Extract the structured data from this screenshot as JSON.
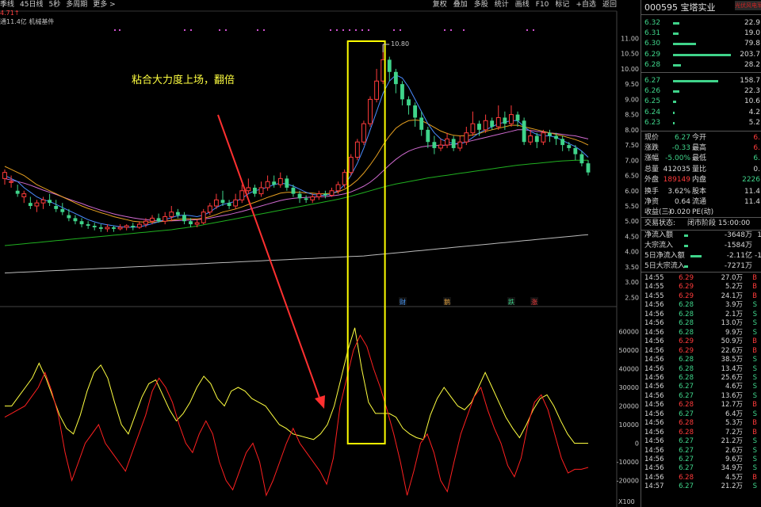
{
  "toolbar": {
    "left_items": [
      "季线",
      "45日线",
      "5秒",
      "多周期",
      "更多 >"
    ],
    "right_items": [
      "复权",
      "叠加",
      "多股",
      "统计",
      "画线",
      "F10",
      "标记",
      "+自选",
      "返回"
    ]
  },
  "chart_info": {
    "price_marker": "4.71↑",
    "flow_line": "通11.4亿 机械基件"
  },
  "annotation": {
    "text": "粘合大力度上场，翻倍",
    "high_label": "10.80"
  },
  "event_markers": [
    {
      "text": "财",
      "color": "#4a9cff"
    },
    {
      "text": "鹅",
      "color": "#e0a040"
    },
    {
      "text": "跌",
      "color": "#3fd48a"
    },
    {
      "text": "涨",
      "color": "#ff4040"
    }
  ],
  "price_axis": {
    "labels": [
      "11.00",
      "10.50",
      "10.00",
      "9.50",
      "9.00",
      "8.50",
      "8.00",
      "7.50",
      "7.00",
      "6.50",
      "6.00",
      "5.50",
      "5.00",
      "4.50",
      "4.00",
      "3.50",
      "3.00",
      "2.50"
    ],
    "range": [
      2.25,
      11.35
    ]
  },
  "indicator_axis": {
    "labels": [
      "60000",
      "50000",
      "40000",
      "30000",
      "20000",
      "10000",
      "0",
      "-10000",
      "-20000"
    ],
    "range": [
      -30000,
      70000
    ],
    "corner_label": "X100"
  },
  "quote": {
    "code": "000595",
    "name": "宝塔实业",
    "tag": "光伏风电军工",
    "asks": [
      {
        "price": "6.32",
        "vol": "22.9"
      },
      {
        "price": "6.31",
        "vol": "19.0"
      },
      {
        "price": "6.30",
        "vol": "79.8"
      },
      {
        "price": "6.29",
        "vol": "203.7"
      },
      {
        "price": "6.28",
        "vol": "28.2"
      }
    ],
    "bids": [
      {
        "price": "6.27",
        "vol": "158.7"
      },
      {
        "price": "6.26",
        "vol": "22.3"
      },
      {
        "price": "6.25",
        "vol": "10.6"
      },
      {
        "price": "6.24",
        "vol": "4.2"
      },
      {
        "price": "6.23",
        "vol": "5.2"
      }
    ],
    "stats": [
      {
        "l1": "现价",
        "v1": "6.27",
        "c1": "cg",
        "l2": "今开",
        "v2": "6.",
        "c2": "cr"
      },
      {
        "l1": "涨跌",
        "v1": "-0.33",
        "c1": "cg",
        "l2": "最高",
        "v2": "6.",
        "c2": "cr"
      },
      {
        "l1": "涨幅",
        "v1": "-5.00%",
        "c1": "cg",
        "l2": "最低",
        "v2": "6.",
        "c2": "cg"
      },
      {
        "l1": "总量",
        "v1": "412035",
        "c1": "cw",
        "l2": "量比",
        "v2": "0.",
        "c2": "cw"
      },
      {
        "l1": "外盘",
        "v1": "189149",
        "c1": "cr",
        "l2": "内盘",
        "v2": "2226",
        "c2": "cg"
      },
      {
        "l1": "换手",
        "v1": "3.62%",
        "c1": "cw",
        "l2": "股本",
        "v2": "11.4",
        "c2": "cw"
      },
      {
        "l1": "净资",
        "v1": "0.64",
        "c1": "cw",
        "l2": "流通",
        "v2": "11.4",
        "c2": "cw"
      },
      {
        "l1": "收益(三)",
        "v1": "-0.020",
        "c1": "cw",
        "l2": "PE(动)",
        "v2": "",
        "c2": "cw"
      }
    ],
    "status_label": "交易状态:",
    "status_value": "闭市阶段 15:00:00",
    "flows": [
      {
        "label": "净流入额",
        "value": "-3648万",
        "extra": "1"
      },
      {
        "label": "大宗流入",
        "value": "-1584万",
        "extra": ""
      },
      {
        "label": "5日净流入额",
        "value": "-2.11亿",
        "extra": "-1"
      },
      {
        "label": "5日大宗流入",
        "value": "-7271万",
        "extra": ""
      }
    ],
    "trades": [
      [
        "14:55",
        "6.29",
        "27.0万",
        "B"
      ],
      [
        "14:55",
        "6.29",
        "5.2万",
        "B"
      ],
      [
        "14:55",
        "6.29",
        "24.1万",
        "B"
      ],
      [
        "14:56",
        "6.28",
        "3.9万",
        "S"
      ],
      [
        "14:56",
        "6.28",
        "2.1万",
        "S"
      ],
      [
        "14:56",
        "6.28",
        "13.0万",
        "S"
      ],
      [
        "14:56",
        "6.28",
        "9.9万",
        "S"
      ],
      [
        "14:56",
        "6.29",
        "50.9万",
        "B"
      ],
      [
        "14:56",
        "6.29",
        "22.6万",
        "B"
      ],
      [
        "14:56",
        "6.28",
        "38.5万",
        "S"
      ],
      [
        "14:56",
        "6.28",
        "13.4万",
        "S"
      ],
      [
        "14:56",
        "6.28",
        "25.6万",
        "S"
      ],
      [
        "14:56",
        "6.27",
        "4.6万",
        "S"
      ],
      [
        "14:56",
        "6.27",
        "13.6万",
        "S"
      ],
      [
        "14:56",
        "6.28",
        "12.7万",
        "B"
      ],
      [
        "14:56",
        "6.27",
        "6.4万",
        "S"
      ],
      [
        "14:56",
        "6.28",
        "5.3万",
        "B"
      ],
      [
        "14:56",
        "6.28",
        "7.2万",
        "B"
      ],
      [
        "14:56",
        "6.27",
        "21.2万",
        "S"
      ],
      [
        "14:56",
        "6.27",
        "2.6万",
        "S"
      ],
      [
        "14:56",
        "6.27",
        "9.6万",
        "S"
      ],
      [
        "14:56",
        "6.27",
        "34.9万",
        "S"
      ],
      [
        "14:56",
        "6.28",
        "4.5万",
        "B"
      ],
      [
        "14:57",
        "6.27",
        "21.2万",
        "S"
      ]
    ]
  },
  "colors": {
    "up": "#ff3b3b",
    "down": "#3fd48a",
    "ma_blue": "#4a8cff",
    "ma_orange": "#e6a020",
    "ma_magenta": "#d06ad0",
    "ma_green": "#20b020",
    "ma_gray": "#bbbbbb",
    "ind_yellow": "#ffff40",
    "ind_red": "#ff2020",
    "highlight_box": "#ffff00",
    "arrow": "#ff3030"
  },
  "chart_data": {
    "type": "candlestick",
    "candles": [
      [
        6.4,
        6.6,
        6.7,
        6.2
      ],
      [
        6.3,
        6.3,
        6.5,
        6.1
      ],
      [
        6.0,
        5.9,
        6.2,
        5.8
      ],
      [
        5.8,
        5.9,
        6.0,
        5.6
      ],
      [
        5.6,
        5.5,
        5.8,
        5.4
      ],
      [
        5.5,
        5.6,
        5.7,
        5.3
      ],
      [
        5.6,
        5.7,
        5.8,
        5.4
      ],
      [
        5.7,
        5.6,
        5.9,
        5.5
      ],
      [
        5.5,
        5.4,
        5.7,
        5.3
      ],
      [
        5.4,
        5.3,
        5.6,
        5.2
      ],
      [
        5.2,
        5.1,
        5.4,
        5.0
      ],
      [
        5.1,
        5.0,
        5.2,
        4.9
      ],
      [
        5.0,
        4.9,
        5.1,
        4.8
      ],
      [
        4.9,
        4.85,
        5.0,
        4.75
      ],
      [
        4.85,
        4.8,
        4.95,
        4.7
      ],
      [
        4.8,
        4.75,
        4.9,
        4.65
      ],
      [
        4.75,
        4.8,
        4.9,
        4.65
      ],
      [
        4.8,
        4.75,
        4.85,
        4.65
      ],
      [
        4.75,
        4.8,
        4.9,
        4.7
      ],
      [
        4.8,
        4.85,
        4.9,
        4.7
      ],
      [
        4.85,
        4.8,
        4.95,
        4.7
      ],
      [
        4.8,
        4.9,
        5.0,
        4.75
      ],
      [
        4.9,
        5.0,
        5.1,
        4.8
      ],
      [
        5.0,
        5.1,
        5.2,
        4.9
      ],
      [
        5.1,
        5.0,
        5.25,
        4.95
      ],
      [
        5.0,
        5.15,
        5.3,
        4.9
      ],
      [
        5.15,
        5.3,
        5.5,
        5.0
      ],
      [
        5.3,
        5.2,
        5.4,
        5.1
      ],
      [
        5.2,
        5.0,
        5.3,
        4.9
      ],
      [
        5.0,
        4.9,
        5.1,
        4.8
      ],
      [
        4.9,
        4.95,
        5.05,
        4.8
      ],
      [
        4.95,
        5.3,
        5.4,
        4.9
      ],
      [
        5.3,
        5.5,
        5.6,
        5.2
      ],
      [
        5.5,
        5.7,
        5.9,
        5.4
      ],
      [
        5.7,
        5.6,
        6.0,
        5.5
      ],
      [
        5.6,
        5.5,
        5.7,
        5.4
      ],
      [
        5.5,
        5.7,
        5.9,
        5.4
      ],
      [
        5.7,
        6.0,
        6.2,
        5.6
      ],
      [
        6.0,
        6.1,
        6.4,
        5.9
      ],
      [
        6.1,
        5.9,
        6.2,
        5.8
      ],
      [
        5.9,
        6.1,
        6.3,
        5.8
      ],
      [
        6.1,
        6.3,
        6.5,
        6.0
      ],
      [
        6.3,
        6.2,
        6.5,
        6.1
      ],
      [
        6.2,
        6.4,
        6.6,
        6.1
      ],
      [
        6.4,
        6.1,
        6.5,
        6.0
      ],
      [
        6.1,
        5.9,
        6.2,
        5.8
      ],
      [
        5.9,
        5.75,
        6.0,
        5.6
      ],
      [
        5.75,
        5.7,
        5.85,
        5.6
      ],
      [
        5.7,
        5.8,
        5.9,
        5.6
      ],
      [
        5.8,
        5.9,
        6.0,
        5.7
      ],
      [
        5.9,
        5.85,
        6.0,
        5.75
      ],
      [
        5.85,
        6.0,
        6.1,
        5.8
      ],
      [
        6.0,
        6.2,
        6.3,
        5.9
      ],
      [
        6.2,
        6.6,
        6.7,
        6.1
      ],
      [
        6.6,
        7.1,
        7.2,
        6.5
      ],
      [
        7.1,
        7.6,
        7.7,
        7.0
      ],
      [
        7.6,
        8.2,
        8.3,
        7.5
      ],
      [
        8.2,
        9.0,
        9.1,
        8.1
      ],
      [
        9.0,
        9.6,
        10.0,
        8.9
      ],
      [
        9.6,
        10.3,
        10.8,
        9.5
      ],
      [
        10.3,
        9.9,
        10.4,
        9.6
      ],
      [
        9.9,
        9.5,
        10.0,
        9.2
      ],
      [
        9.5,
        9.0,
        9.6,
        8.8
      ],
      [
        9.0,
        8.8,
        9.1,
        8.5
      ],
      [
        8.8,
        8.4,
        8.9,
        8.1
      ],
      [
        8.4,
        8.0,
        8.6,
        7.8
      ],
      [
        8.0,
        7.6,
        8.1,
        7.4
      ],
      [
        7.6,
        7.4,
        7.8,
        7.2
      ],
      [
        7.4,
        7.5,
        7.7,
        7.3
      ],
      [
        7.5,
        7.7,
        7.9,
        7.4
      ],
      [
        7.7,
        7.4,
        7.8,
        7.3
      ],
      [
        7.4,
        7.6,
        7.8,
        7.3
      ],
      [
        7.6,
        7.9,
        8.1,
        7.5
      ],
      [
        7.9,
        8.2,
        8.6,
        7.8
      ],
      [
        8.2,
        8.0,
        8.3,
        7.8
      ],
      [
        8.0,
        8.3,
        8.5,
        7.9
      ],
      [
        8.3,
        8.1,
        8.4,
        8.0
      ],
      [
        8.1,
        8.4,
        8.8,
        8.0
      ],
      [
        8.4,
        8.2,
        8.6,
        8.0
      ],
      [
        8.2,
        8.5,
        8.8,
        8.1
      ],
      [
        8.5,
        8.3,
        8.6,
        8.1
      ],
      [
        8.3,
        7.6,
        8.4,
        7.5
      ],
      [
        7.6,
        7.8,
        8.0,
        7.5
      ],
      [
        7.8,
        7.6,
        7.9,
        7.4
      ],
      [
        7.6,
        7.9,
        8.0,
        7.5
      ],
      [
        7.9,
        7.8,
        8.0,
        7.6
      ],
      [
        7.8,
        7.7,
        7.9,
        7.5
      ],
      [
        7.7,
        7.5,
        7.8,
        7.3
      ],
      [
        7.5,
        7.4,
        7.6,
        7.3
      ],
      [
        7.4,
        7.2,
        7.5,
        7.0
      ],
      [
        7.2,
        6.9,
        7.3,
        6.8
      ],
      [
        6.9,
        6.6,
        7.0,
        6.5
      ]
    ],
    "ma_blue": [
      6.5,
      6.4,
      6.3,
      6.1,
      5.95,
      5.8,
      5.7,
      5.65,
      5.55,
      5.45,
      5.35,
      5.25,
      5.15,
      5.05,
      4.98,
      4.92,
      4.88,
      4.85,
      4.82,
      4.8,
      4.8,
      4.82,
      4.86,
      4.92,
      4.98,
      5.05,
      5.12,
      5.18,
      5.2,
      5.18,
      5.15,
      5.2,
      5.3,
      5.45,
      5.55,
      5.6,
      5.65,
      5.75,
      5.9,
      6.0,
      6.05,
      6.12,
      6.2,
      6.25,
      6.22,
      6.15,
      6.05,
      5.95,
      5.88,
      5.85,
      5.85,
      5.9,
      6.0,
      6.2,
      6.5,
      6.9,
      7.4,
      8.0,
      8.6,
      9.2,
      9.6,
      9.8,
      9.7,
      9.4,
      9.0,
      8.6,
      8.2,
      7.9,
      7.7,
      7.6,
      7.55,
      7.55,
      7.6,
      7.75,
      7.9,
      8.0,
      8.1,
      8.2,
      8.25,
      8.3,
      8.3,
      8.1,
      7.95,
      7.85,
      7.8,
      7.8,
      7.75,
      7.65,
      7.55,
      7.45,
      7.3,
      7.1
    ],
    "ma_orange": [
      6.8,
      6.7,
      6.6,
      6.5,
      6.35,
      6.2,
      6.1,
      6.0,
      5.9,
      5.8,
      5.7,
      5.6,
      5.5,
      5.42,
      5.35,
      5.28,
      5.22,
      5.15,
      5.1,
      5.05,
      5.0,
      4.98,
      4.97,
      4.97,
      4.98,
      5.0,
      5.03,
      5.06,
      5.08,
      5.08,
      5.07,
      5.1,
      5.15,
      5.22,
      5.3,
      5.35,
      5.4,
      5.47,
      5.55,
      5.62,
      5.7,
      5.78,
      5.85,
      5.92,
      5.95,
      5.95,
      5.95,
      5.93,
      5.92,
      5.9,
      5.9,
      5.92,
      5.96,
      6.05,
      6.18,
      6.35,
      6.58,
      6.85,
      7.15,
      7.5,
      7.8,
      8.05,
      8.2,
      8.3,
      8.32,
      8.3,
      8.2,
      8.08,
      7.96,
      7.88,
      7.82,
      7.8,
      7.8,
      7.83,
      7.88,
      7.95,
      8.0,
      8.05,
      8.1,
      8.15,
      8.15,
      8.1,
      8.05,
      8.0,
      7.95,
      7.9,
      7.85,
      7.8,
      7.74,
      7.68,
      7.6,
      7.5
    ],
    "ma_magenta": [
      6.4,
      6.35,
      6.3,
      6.25,
      6.18,
      6.1,
      6.02,
      5.95,
      5.88,
      5.8,
      5.72,
      5.65,
      5.58,
      5.5,
      5.43,
      5.36,
      5.3,
      5.24,
      5.19,
      5.15,
      5.11,
      5.08,
      5.05,
      5.03,
      5.02,
      5.01,
      5.01,
      5.02,
      5.03,
      5.04,
      5.05,
      5.07,
      5.1,
      5.14,
      5.18,
      5.22,
      5.27,
      5.32,
      5.38,
      5.44,
      5.5,
      5.56,
      5.62,
      5.68,
      5.72,
      5.75,
      5.77,
      5.78,
      5.79,
      5.8,
      5.81,
      5.83,
      5.86,
      5.9,
      5.96,
      6.05,
      6.15,
      6.28,
      6.45,
      6.65,
      6.85,
      7.03,
      7.18,
      7.3,
      7.38,
      7.44,
      7.47,
      7.48,
      7.49,
      7.5,
      7.52,
      7.55,
      7.6,
      7.65,
      7.7,
      7.75,
      7.8,
      7.85,
      7.9,
      7.95,
      8.0,
      8.0,
      7.98,
      7.95,
      7.93,
      7.9,
      7.88,
      7.85,
      7.82,
      7.8,
      7.75,
      7.7
    ],
    "ma_green": [
      4.2,
      4.22,
      4.24,
      4.26,
      4.28,
      4.3,
      4.32,
      4.34,
      4.36,
      4.38,
      4.4,
      4.42,
      4.44,
      4.46,
      4.48,
      4.5,
      4.52,
      4.54,
      4.56,
      4.58,
      4.6,
      4.62,
      4.64,
      4.66,
      4.68,
      4.7,
      4.72,
      4.75,
      4.78,
      4.81,
      4.84,
      4.88,
      4.92,
      4.96,
      5.0,
      5.04,
      5.08,
      5.12,
      5.16,
      5.2,
      5.24,
      5.28,
      5.32,
      5.36,
      5.4,
      5.44,
      5.48,
      5.52,
      5.56,
      5.6,
      5.64,
      5.68,
      5.72,
      5.77,
      5.82,
      5.88,
      5.94,
      6.0,
      6.06,
      6.12,
      6.17,
      6.22,
      6.26,
      6.3,
      6.34,
      6.38,
      6.42,
      6.45,
      6.48,
      6.51,
      6.54,
      6.57,
      6.6,
      6.63,
      6.66,
      6.69,
      6.72,
      6.75,
      6.78,
      6.81,
      6.84,
      6.86,
      6.88,
      6.9,
      6.92,
      6.94,
      6.96,
      6.98,
      6.99,
      7.0,
      7.0,
      7.0
    ],
    "ma_gray": [
      3.3,
      3.31,
      3.32,
      3.33,
      3.34,
      3.35,
      3.36,
      3.37,
      3.38,
      3.39,
      3.4,
      3.41,
      3.42,
      3.43,
      3.44,
      3.45,
      3.46,
      3.47,
      3.48,
      3.49,
      3.5,
      3.51,
      3.52,
      3.53,
      3.54,
      3.55,
      3.56,
      3.57,
      3.58,
      3.59,
      3.6,
      3.61,
      3.62,
      3.63,
      3.64,
      3.65,
      3.66,
      3.67,
      3.68,
      3.69,
      3.7,
      3.71,
      3.72,
      3.73,
      3.74,
      3.75,
      3.76,
      3.77,
      3.78,
      3.79,
      3.8,
      3.81,
      3.82,
      3.83,
      3.84,
      3.85,
      3.86,
      3.88,
      3.9,
      3.92,
      3.94,
      3.96,
      3.98,
      4.0,
      4.02,
      4.04,
      4.06,
      4.08,
      4.1,
      4.12,
      4.14,
      4.16,
      4.18,
      4.2,
      4.22,
      4.24,
      4.26,
      4.28,
      4.3,
      4.32,
      4.34,
      4.36,
      4.38,
      4.4,
      4.42,
      4.44,
      4.46,
      4.48,
      4.5,
      4.52,
      4.54,
      4.56
    ],
    "indicator_yellow": [
      20000,
      20000,
      25000,
      30000,
      35000,
      43000,
      35000,
      25000,
      15000,
      8000,
      5000,
      15000,
      28000,
      38000,
      42000,
      35000,
      22000,
      10000,
      5000,
      15000,
      25000,
      32000,
      34000,
      26000,
      18000,
      12000,
      16000,
      22000,
      30000,
      36000,
      32000,
      24000,
      20000,
      28000,
      30000,
      28000,
      24000,
      22000,
      20000,
      15000,
      10000,
      8000,
      5000,
      4000,
      3000,
      2000,
      5000,
      10000,
      20000,
      35000,
      50000,
      62000,
      40000,
      22000,
      16000,
      16000,
      16000,
      14000,
      8000,
      5000,
      3000,
      2000,
      15000,
      24000,
      30000,
      25000,
      20000,
      18000,
      22000,
      30000,
      38000,
      30000,
      22000,
      14000,
      8000,
      3000,
      10000,
      18000,
      24000,
      26000,
      20000,
      12000,
      5000,
      0,
      0,
      0
    ],
    "indicator_red": [
      14000,
      16000,
      18000,
      20000,
      25000,
      30000,
      38000,
      28000,
      15000,
      -5000,
      -20000,
      -10000,
      0,
      5000,
      10000,
      0,
      -5000,
      -10000,
      -15000,
      -5000,
      5000,
      15000,
      28000,
      35000,
      30000,
      22000,
      10000,
      0,
      -5000,
      5000,
      12000,
      5000,
      -10000,
      -20000,
      -25000,
      -15000,
      -5000,
      0,
      -10000,
      -28000,
      -20000,
      -10000,
      0,
      8000,
      0,
      -5000,
      -10000,
      -15000,
      -22000,
      -8000,
      20000,
      35000,
      50000,
      58000,
      52000,
      40000,
      30000,
      18000,
      5000,
      -10000,
      -28000,
      -15000,
      0,
      5000,
      -5000,
      -20000,
      -26000,
      -10000,
      5000,
      15000,
      25000,
      30000,
      18000,
      8000,
      0,
      -12000,
      -18000,
      -8000,
      10000,
      22000,
      26000,
      18000,
      5000,
      -8000,
      -16000,
      -14000,
      -14000,
      -13000
    ]
  }
}
